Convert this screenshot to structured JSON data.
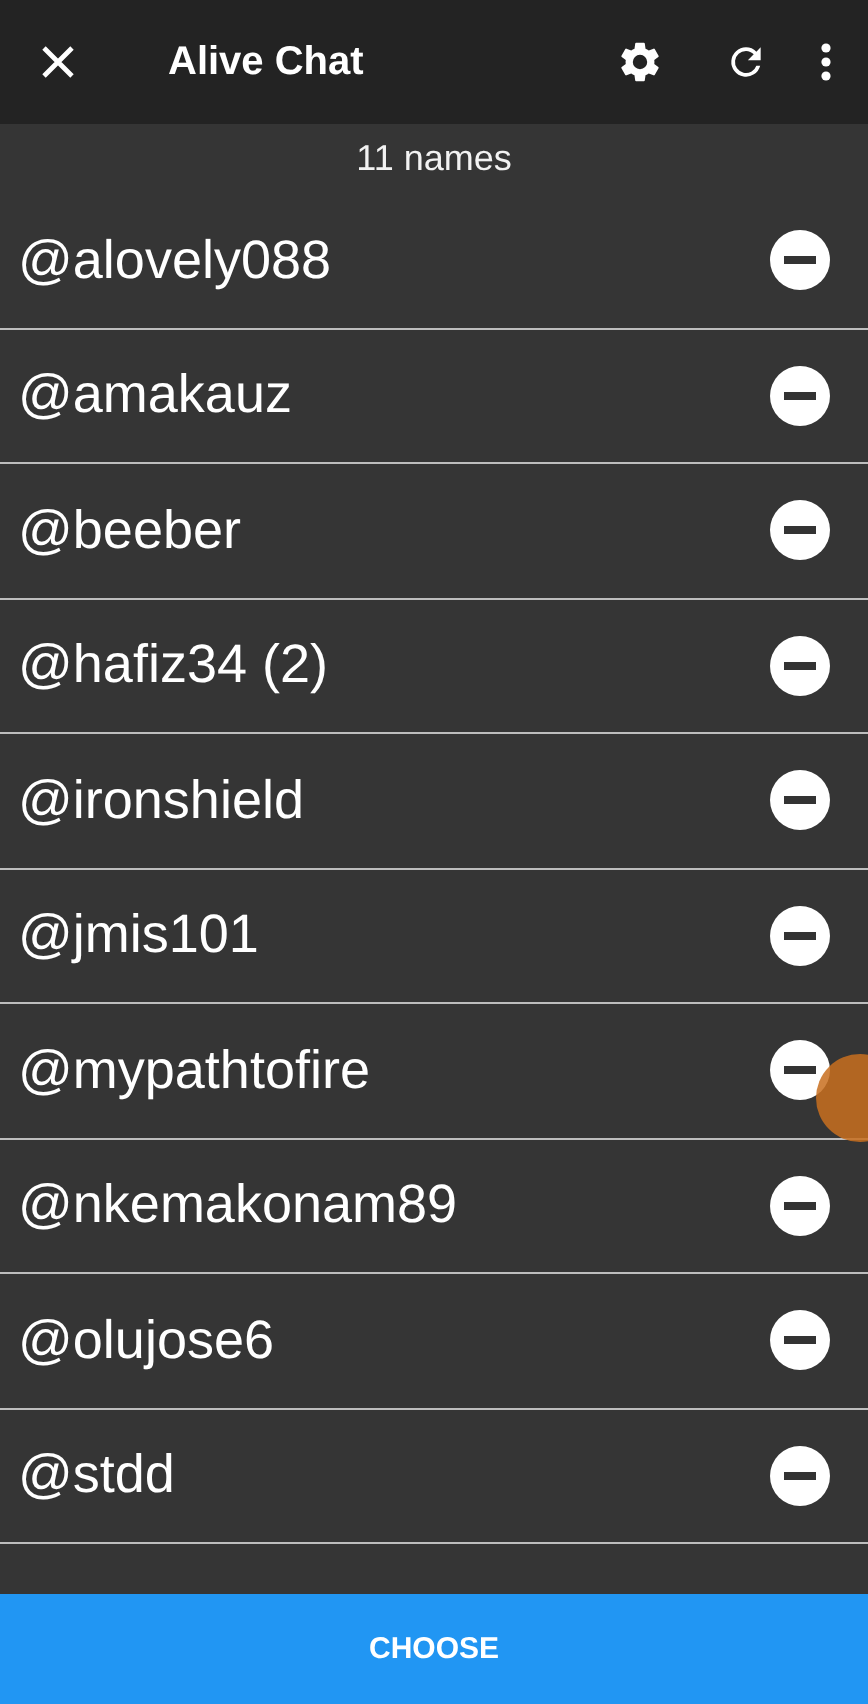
{
  "toolbar": {
    "title": "Alive Chat"
  },
  "count": "11 names",
  "names": [
    {
      "name": "@alovely088"
    },
    {
      "name": "@amakauz"
    },
    {
      "name": "@beeber"
    },
    {
      "name": "@hafiz34 (2)"
    },
    {
      "name": "@ironshield"
    },
    {
      "name": "@jmis101"
    },
    {
      "name": "@mypathtofire"
    },
    {
      "name": "@nkemakonam89"
    },
    {
      "name": "@olujose6"
    },
    {
      "name": "@stdd"
    }
  ],
  "button": "CHOOSE"
}
